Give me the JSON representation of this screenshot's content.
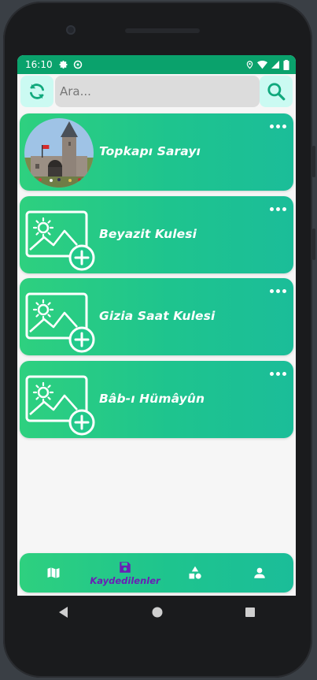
{
  "status_bar": {
    "time": "16:10",
    "left_icons": [
      "gear-icon",
      "vpn-icon"
    ],
    "right_icons": [
      "location-icon",
      "wifi-icon",
      "signal-icon",
      "battery-icon"
    ],
    "color": "#0aa26c"
  },
  "search": {
    "placeholder": "Ara...",
    "value": "",
    "refresh_icon": "refresh-icon",
    "search_icon": "search-icon"
  },
  "places": [
    {
      "title": "Topkapı Sarayı",
      "image": "photo",
      "menu_icon": "more-horizontal-icon"
    },
    {
      "title": "Beyazit Kulesi",
      "image": "add-photo-placeholder",
      "menu_icon": "more-horizontal-icon"
    },
    {
      "title": "Gizia Saat Kulesi",
      "image": "add-photo-placeholder",
      "menu_icon": "more-horizontal-icon"
    },
    {
      "title": "Bâb-ı Hümâyûn",
      "image": "add-photo-placeholder",
      "menu_icon": "more-horizontal-icon"
    }
  ],
  "bottom_nav": {
    "items": [
      {
        "icon": "map-icon",
        "label": ""
      },
      {
        "icon": "save-icon",
        "label": "Kaydedilenler",
        "active": true
      },
      {
        "icon": "shapes-icon",
        "label": ""
      },
      {
        "icon": "person-icon",
        "label": ""
      }
    ],
    "active_color": "#6a1fb5"
  },
  "colors": {
    "card_gradient_start": "#2ed07f",
    "card_gradient_end": "#1bbd99",
    "button_bg": "#cbfaf2",
    "icon_accent": "#11a97d"
  }
}
